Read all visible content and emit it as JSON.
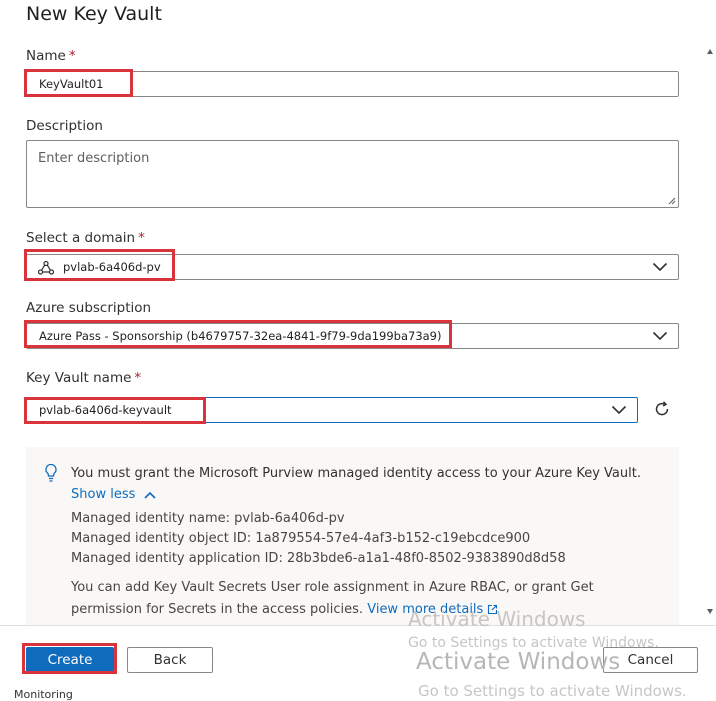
{
  "panel": {
    "title": "New Key Vault"
  },
  "name_field": {
    "label": "Name",
    "required": "*",
    "value": "KeyVault01"
  },
  "description_field": {
    "label": "Description",
    "placeholder": "Enter description"
  },
  "domain_field": {
    "label": "Select a domain",
    "required": "*",
    "value": "pvlab-6a406d-pv"
  },
  "subscription_field": {
    "label": "Azure subscription",
    "value": "Azure Pass - Sponsorship (b4679757-32ea-4841-9f79-9da199ba73a9)"
  },
  "keyvault_field": {
    "label": "Key Vault name",
    "required": "*",
    "value": "pvlab-6a406d-keyvault"
  },
  "info": {
    "message": "You must grant the Microsoft Purview managed identity access to your Azure Key Vault.",
    "show_less": "Show less",
    "identity_name": "Managed identity name: pvlab-6a406d-pv",
    "identity_object_id": "Managed identity object ID: 1a879554-57e4-4af3-b152-c19ebcdce900",
    "identity_app_id": "Managed identity application ID: 28b3bde6-a1a1-48f0-8502-9383890d8d58",
    "rbac_line1": "You can add Key Vault Secrets User role assignment in Azure RBAC, or grant Get",
    "rbac_line2": "permission for Secrets in the access policies.",
    "view_more": "View more details"
  },
  "footer": {
    "create": "Create",
    "back": "Back",
    "cancel": "Cancel"
  },
  "watermark": {
    "line1": "Activate Windows",
    "line2": "Go to Settings to activate Windows.",
    "line3": "Activate Windows",
    "line4": "Go to Settings to activate Windows."
  },
  "bottom": {
    "monitoring": "Monitoring"
  },
  "colors": {
    "accent": "#0f6cbd",
    "highlight": "#d9343c",
    "required": "#a4262c"
  }
}
